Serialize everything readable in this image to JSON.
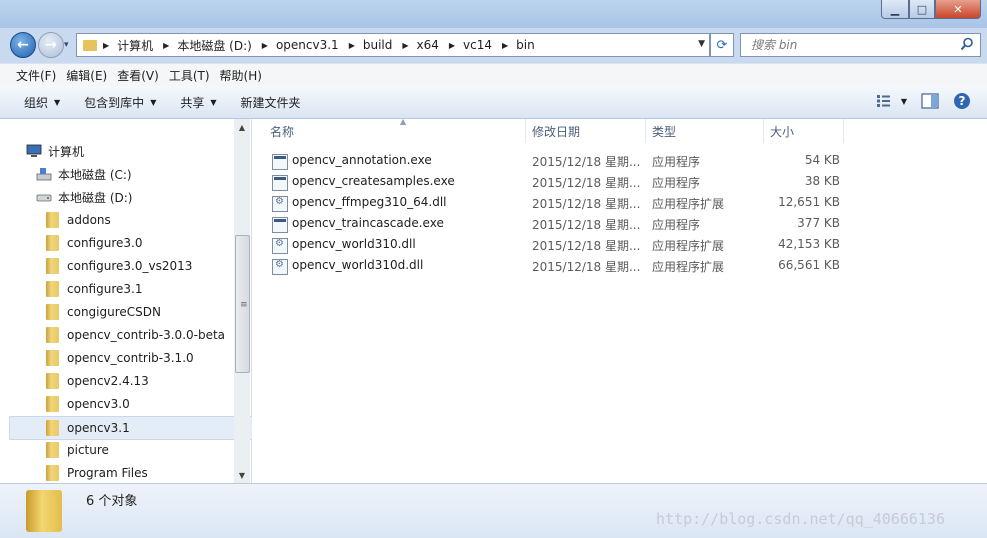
{
  "window": {
    "controls": {
      "minimize": "▁",
      "maximize": "□",
      "close": "✕"
    }
  },
  "nav": {
    "history_arrow": "▾",
    "breadcrumbs": [
      "计算机",
      "本地磁盘 (D:)",
      "opencv3.1",
      "build",
      "x64",
      "vc14",
      "bin"
    ],
    "search_placeholder": "搜索 bin"
  },
  "menubar": [
    "文件(F)",
    "编辑(E)",
    "查看(V)",
    "工具(T)",
    "帮助(H)"
  ],
  "toolbar": {
    "organize": "组织",
    "include_in_library": "包含到库中",
    "share": "共享",
    "new_folder": "新建文件夹"
  },
  "navpane": {
    "items": [
      {
        "label": "计算机",
        "icon": "computer-icon",
        "level": 0
      },
      {
        "label": "本地磁盘 (C:)",
        "icon": "drive-c-icon",
        "level": 1
      },
      {
        "label": "本地磁盘 (D:)",
        "icon": "drive-icon",
        "level": 1
      },
      {
        "label": "addons",
        "icon": "folder-icon",
        "level": 2
      },
      {
        "label": "configure3.0",
        "icon": "folder-icon",
        "level": 2
      },
      {
        "label": "configure3.0_vs2013",
        "icon": "folder-icon",
        "level": 2
      },
      {
        "label": "configure3.1",
        "icon": "folder-icon",
        "level": 2
      },
      {
        "label": "congigureCSDN",
        "icon": "folder-icon",
        "level": 2
      },
      {
        "label": "opencv_contrib-3.0.0-beta",
        "icon": "folder-icon",
        "level": 2
      },
      {
        "label": "opencv_contrib-3.1.0",
        "icon": "folder-icon",
        "level": 2
      },
      {
        "label": "opencv2.4.13",
        "icon": "folder-icon",
        "level": 2
      },
      {
        "label": "opencv3.0",
        "icon": "folder-icon",
        "level": 2
      },
      {
        "label": "opencv3.1",
        "icon": "folder-icon",
        "level": 2,
        "selected": true
      },
      {
        "label": "picture",
        "icon": "folder-icon",
        "level": 2
      },
      {
        "label": "Program Files",
        "icon": "folder-icon",
        "level": 2
      }
    ],
    "scroll_glyphs": {
      "up": "▲",
      "down": "▼",
      "grip": "≡"
    }
  },
  "filelist": {
    "columns": {
      "name": "名称",
      "date": "修改日期",
      "type": "类型",
      "size": "大小"
    },
    "rows": [
      {
        "name": "opencv_annotation.exe",
        "date": "2015/12/18 星期...",
        "type": "应用程序",
        "size": "54 KB",
        "kind": "exe"
      },
      {
        "name": "opencv_createsamples.exe",
        "date": "2015/12/18 星期...",
        "type": "应用程序",
        "size": "38 KB",
        "kind": "exe"
      },
      {
        "name": "opencv_ffmpeg310_64.dll",
        "date": "2015/12/18 星期...",
        "type": "应用程序扩展",
        "size": "12,651 KB",
        "kind": "dll"
      },
      {
        "name": "opencv_traincascade.exe",
        "date": "2015/12/18 星期...",
        "type": "应用程序",
        "size": "377 KB",
        "kind": "exe"
      },
      {
        "name": "opencv_world310.dll",
        "date": "2015/12/18 星期...",
        "type": "应用程序扩展",
        "size": "42,153 KB",
        "kind": "dll"
      },
      {
        "name": "opencv_world310d.dll",
        "date": "2015/12/18 星期...",
        "type": "应用程序扩展",
        "size": "66,561 KB",
        "kind": "dll"
      }
    ]
  },
  "status": {
    "count_text": "6 个对象"
  },
  "watermark": "http://blog.csdn.net/qq_40666136",
  "colors": {
    "titlebar": "#bcd3ee",
    "selection": "#e3ecf7",
    "folder": "#f1d57a"
  }
}
